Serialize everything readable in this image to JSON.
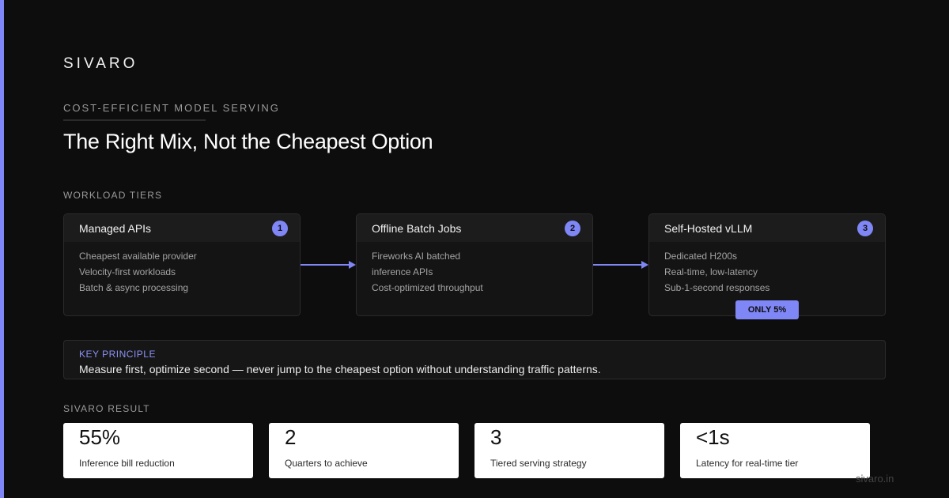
{
  "brand": "SIVARO",
  "kicker": "COST-EFFICIENT MODEL SERVING",
  "title": "The Right Mix, Not the Cheapest Option",
  "workload_label": "WORKLOAD TIERS",
  "tiers": [
    {
      "title": "Managed APIs",
      "number": "1",
      "lines": [
        "Cheapest available provider",
        "Velocity-first workloads",
        "Batch & async processing"
      ]
    },
    {
      "title": "Offline Batch Jobs",
      "number": "2",
      "lines": [
        "Fireworks AI batched",
        "inference APIs",
        "Cost-optimized throughput"
      ]
    },
    {
      "title": "Self-Hosted vLLM",
      "number": "3",
      "lines": [
        "Dedicated H200s",
        "Real-time, low-latency",
        "Sub-1-second responses"
      ],
      "badge": "ONLY 5%"
    }
  ],
  "principle": {
    "label": "KEY PRINCIPLE",
    "text": "Measure first, optimize second — never jump to the cheapest option without understanding traffic patterns."
  },
  "result_label": "SIVARO RESULT",
  "stats": [
    {
      "value": "55%",
      "label": "Inference bill reduction"
    },
    {
      "value": "2",
      "label": "Quarters to achieve"
    },
    {
      "value": "3",
      "label": "Tiered serving strategy"
    },
    {
      "value": "<1s",
      "label": "Latency for real-time tier"
    }
  ],
  "footer_url": "sivaro.in",
  "colors": {
    "accent": "#7f86f5",
    "background": "#0d0d0d",
    "card": "#141414",
    "stat_card": "#ffffff"
  }
}
